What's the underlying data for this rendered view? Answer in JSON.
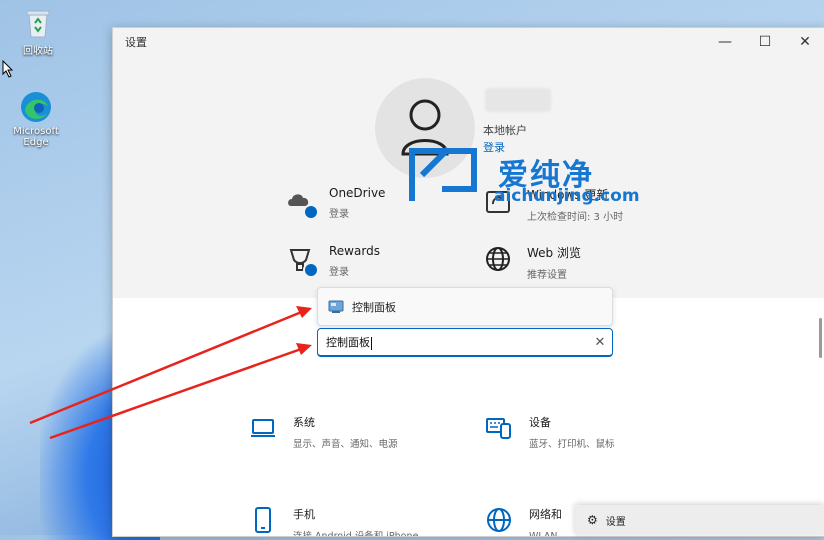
{
  "desktop": {
    "icons": [
      {
        "name": "recycle-bin",
        "label": "回收站"
      },
      {
        "name": "edge",
        "label": "Microsoft Edge"
      }
    ]
  },
  "window": {
    "title": "设置",
    "controls": {
      "minimize": "—",
      "maximize": "☐",
      "close": "✕"
    }
  },
  "account": {
    "name": "本地帐户",
    "action": "登录"
  },
  "tiles": [
    {
      "title": "OneDrive",
      "subtitle": "登录",
      "icon": "cloud-icon"
    },
    {
      "title": "Windows 更新",
      "subtitle": "上次检查时间: 3 小时",
      "icon": "update-icon"
    },
    {
      "title": "Rewards",
      "subtitle": "登录",
      "icon": "trophy-icon"
    },
    {
      "title": "Web 浏览",
      "subtitle": "推荐设置",
      "icon": "globe-icon"
    }
  ],
  "search": {
    "suggestion": "控制面板",
    "value": "控制面板",
    "clear": "✕"
  },
  "categories": [
    {
      "title": "系统",
      "subtitle": "显示、声音、通知、电源",
      "icon": "laptop-icon"
    },
    {
      "title": "设备",
      "subtitle": "蓝牙、打印机、鼠标",
      "icon": "devices-icon"
    },
    {
      "title": "手机",
      "subtitle": "连接 Android 设备和 iPhone",
      "icon": "phone-icon"
    },
    {
      "title": "网络和 ",
      "subtitle": "WLAN、",
      "icon": "network-icon"
    }
  ],
  "popup": {
    "label": "设置",
    "icon": "gear-icon"
  },
  "watermark": {
    "brand": "爱纯净",
    "url": "aichunjing.com"
  },
  "colors": {
    "accent": "#0067c0",
    "annotation": "#e8231c",
    "watermark": "#1677d2"
  }
}
